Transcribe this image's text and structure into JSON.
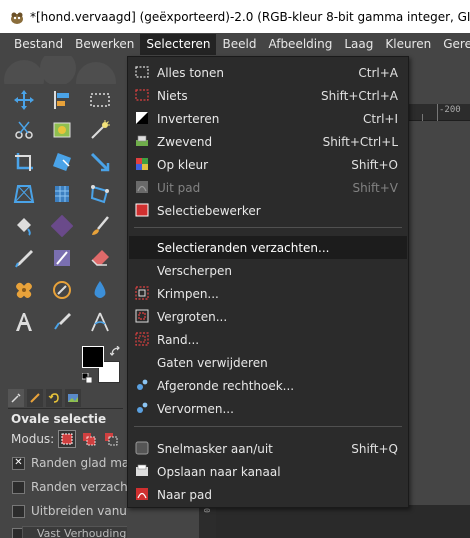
{
  "window": {
    "title": "*[hond.vervaagd] (geëxporteerd)-2.0 (RGB-kleur 8-bit gamma integer, GIMP built-"
  },
  "menubar": {
    "items": [
      {
        "label": "Bestand"
      },
      {
        "label": "Bewerken"
      },
      {
        "label": "Selecteren"
      },
      {
        "label": "Beeld"
      },
      {
        "label": "Afbeelding"
      },
      {
        "label": "Laag"
      },
      {
        "label": "Kleuren"
      },
      {
        "label": "Gereedschap"
      }
    ],
    "active": "Selecteren"
  },
  "select_menu": {
    "items": [
      {
        "label": "Alles tonen",
        "shortcut": "Ctrl+A",
        "icon": "select-all-icon",
        "enabled": true
      },
      {
        "label": "Niets",
        "shortcut": "Shift+Ctrl+A",
        "icon": "select-none-icon",
        "enabled": true
      },
      {
        "label": "Inverteren",
        "shortcut": "Ctrl+I",
        "icon": "invert-icon",
        "enabled": true
      },
      {
        "label": "Zwevend",
        "shortcut": "Shift+Ctrl+L",
        "icon": "float-icon",
        "enabled": true
      },
      {
        "label": "Op kleur",
        "shortcut": "Shift+O",
        "icon": "by-color-icon",
        "enabled": true
      },
      {
        "label": "Uit pad",
        "shortcut": "Shift+V",
        "icon": "from-path-icon",
        "enabled": false
      },
      {
        "label": "Selectiebewerker",
        "shortcut": "",
        "icon": "selection-editor-icon",
        "enabled": true
      },
      {
        "label": "Selectieranden verzachten...",
        "shortcut": "",
        "icon": "",
        "enabled": true,
        "highlighted": true
      },
      {
        "label": "Verscherpen",
        "shortcut": "",
        "icon": "",
        "enabled": true
      },
      {
        "label": "Krimpen...",
        "shortcut": "",
        "icon": "shrink-icon",
        "enabled": true
      },
      {
        "label": "Vergroten...",
        "shortcut": "",
        "icon": "grow-icon",
        "enabled": true
      },
      {
        "label": "Rand...",
        "shortcut": "",
        "icon": "border-icon",
        "enabled": true
      },
      {
        "label": "Gaten verwijderen",
        "shortcut": "",
        "icon": "",
        "enabled": true
      },
      {
        "label": "Afgeronde rechthoek...",
        "shortcut": "",
        "icon": "script-gear-icon",
        "enabled": true
      },
      {
        "label": "Vervormen...",
        "shortcut": "",
        "icon": "script-gear-icon",
        "enabled": true
      },
      {
        "label": "Snelmasker aan/uit",
        "shortcut": "Shift+Q",
        "icon": "quick-mask-icon",
        "enabled": true
      },
      {
        "label": "Opslaan naar kanaal",
        "shortcut": "",
        "icon": "channel-icon",
        "enabled": true
      },
      {
        "label": "Naar pad",
        "shortcut": "",
        "icon": "to-path-icon",
        "enabled": true
      }
    ]
  },
  "tool_options": {
    "title": "Ovale selectie",
    "mode_label": "Modus:",
    "options": [
      {
        "label": "Randen glad maken",
        "checked": true
      },
      {
        "label": "Randen verzachten",
        "checked": false
      },
      {
        "label": "Uitbreiden vanuit het midden",
        "checked": false
      }
    ],
    "bottom_combo": "Vast      Verhouding"
  },
  "ruler": {
    "h_label": "-200",
    "v_label": "0"
  },
  "colors": {
    "foreground": "#000000",
    "background": "#ffffff",
    "menu_bg": "#2b2b2b",
    "ui_bg": "#454545"
  }
}
